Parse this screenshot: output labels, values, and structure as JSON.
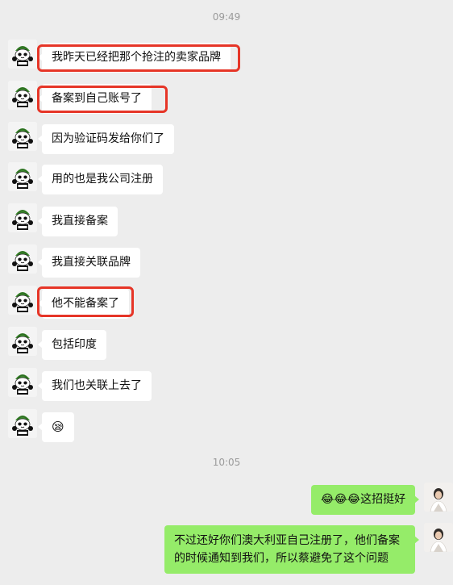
{
  "chat": {
    "timestamp_1": "09:49",
    "timestamp_2": "10:05",
    "incoming": [
      "我昨天已经把那个抢注的卖家品牌",
      "备案到自己账号了",
      "因为验证码发给你们了",
      "用的也是我公司注册",
      "我直接备案",
      "我直接关联品牌",
      "他不能备案了",
      "包括印度",
      "我们也关联上去了",
      "😪"
    ],
    "outgoing": [
      "😂😂😂这招挺好",
      "不过还好你们澳大利亚自己注册了，他们备案的时候通知到我们，所以蔡避免了这个问题"
    ],
    "highlight_color": "#e63527",
    "bubble_color_out": "#95ec69",
    "bubble_color_in": "#ffffff",
    "contact_avatar_icon": "panda-meme-avatar-icon",
    "self_avatar_icon": "person-photo-avatar-icon"
  }
}
